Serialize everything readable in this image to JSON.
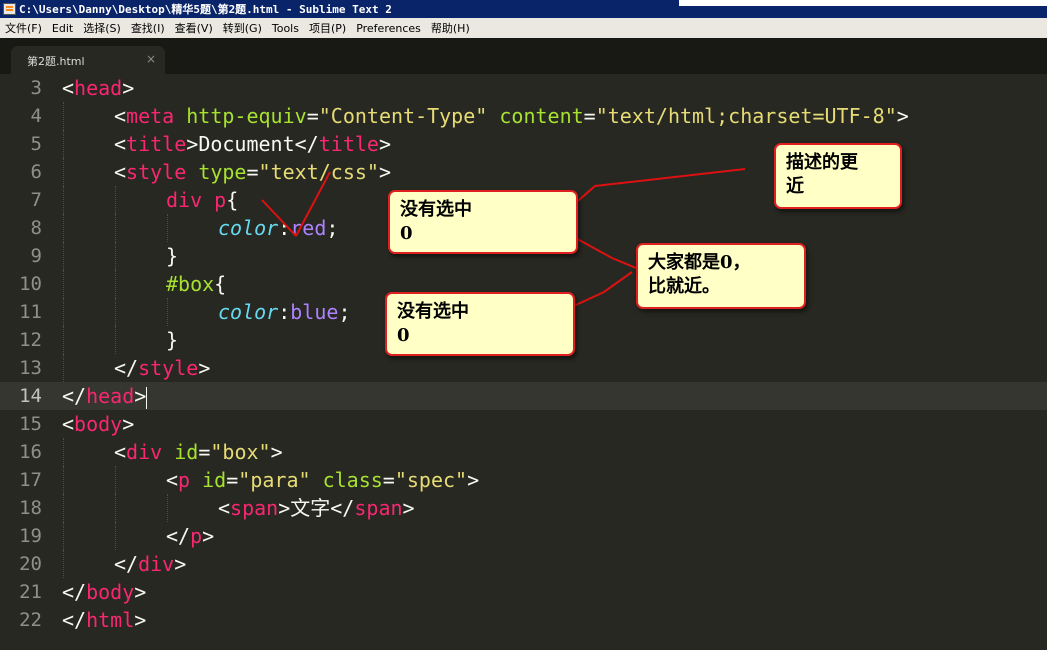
{
  "window": {
    "title": "C:\\Users\\Danny\\Desktop\\精华5题\\第2题.html - Sublime Text 2"
  },
  "menu": [
    "文件(F)",
    "Edit",
    "选择(S)",
    "查找(I)",
    "查看(V)",
    "转到(G)",
    "Tools",
    "项目(P)",
    "Preferences",
    "帮助(H)"
  ],
  "tab": {
    "label": "第2题.html",
    "close": "×"
  },
  "editor": {
    "current_line": 14,
    "lines": [
      {
        "n": "3"
      },
      {
        "n": "4"
      },
      {
        "n": "5"
      },
      {
        "n": "6"
      },
      {
        "n": "7"
      },
      {
        "n": "8"
      },
      {
        "n": "9"
      },
      {
        "n": "10"
      },
      {
        "n": "11"
      },
      {
        "n": "12"
      },
      {
        "n": "13"
      },
      {
        "n": "14"
      },
      {
        "n": "15"
      },
      {
        "n": "16"
      },
      {
        "n": "17"
      },
      {
        "n": "18"
      },
      {
        "n": "19"
      },
      {
        "n": "20"
      },
      {
        "n": "21"
      },
      {
        "n": "22"
      }
    ],
    "tokens": {
      "lt": "<",
      "gt": ">",
      "lts": "</",
      "eq": "=",
      "brace_open": "{",
      "brace_close": "}",
      "colon": ":",
      "semi": ";",
      "head": "head",
      "meta": "meta",
      "http_equiv": "http-equiv",
      "content_type": "\"Content-Type\"",
      "content": "content",
      "content_val": "\"text/html;charset=UTF-8\"",
      "title": "title",
      "document": "Document",
      "style": "style",
      "type": "type",
      "type_val": "\"text/css\"",
      "sel1": "div p",
      "color": "color",
      "red": "red",
      "sel2": "#box",
      "blue": "blue",
      "body": "body",
      "div": "div",
      "id": "id",
      "box_val": "\"box\"",
      "p": "p",
      "para_val": "\"para\"",
      "class": "class",
      "spec_val": "\"spec\"",
      "span": "span",
      "wenzi": "文字"
    }
  },
  "annotations": {
    "describe_closer": [
      "描述的更",
      "近"
    ],
    "not_selected_1": [
      "没有选中",
      "0"
    ],
    "all_zero": [
      "大家都是0，",
      "比就近。"
    ],
    "not_selected_2": [
      "没有选中",
      "0"
    ]
  },
  "colors": {
    "background": "#272822",
    "tag": "#f92672",
    "attribute": "#a6e22e",
    "string": "#e6db74",
    "property": "#66d9ef",
    "number_value": "#ae81ff",
    "note_fill": "#ffffc6",
    "note_border": "#e02020"
  }
}
